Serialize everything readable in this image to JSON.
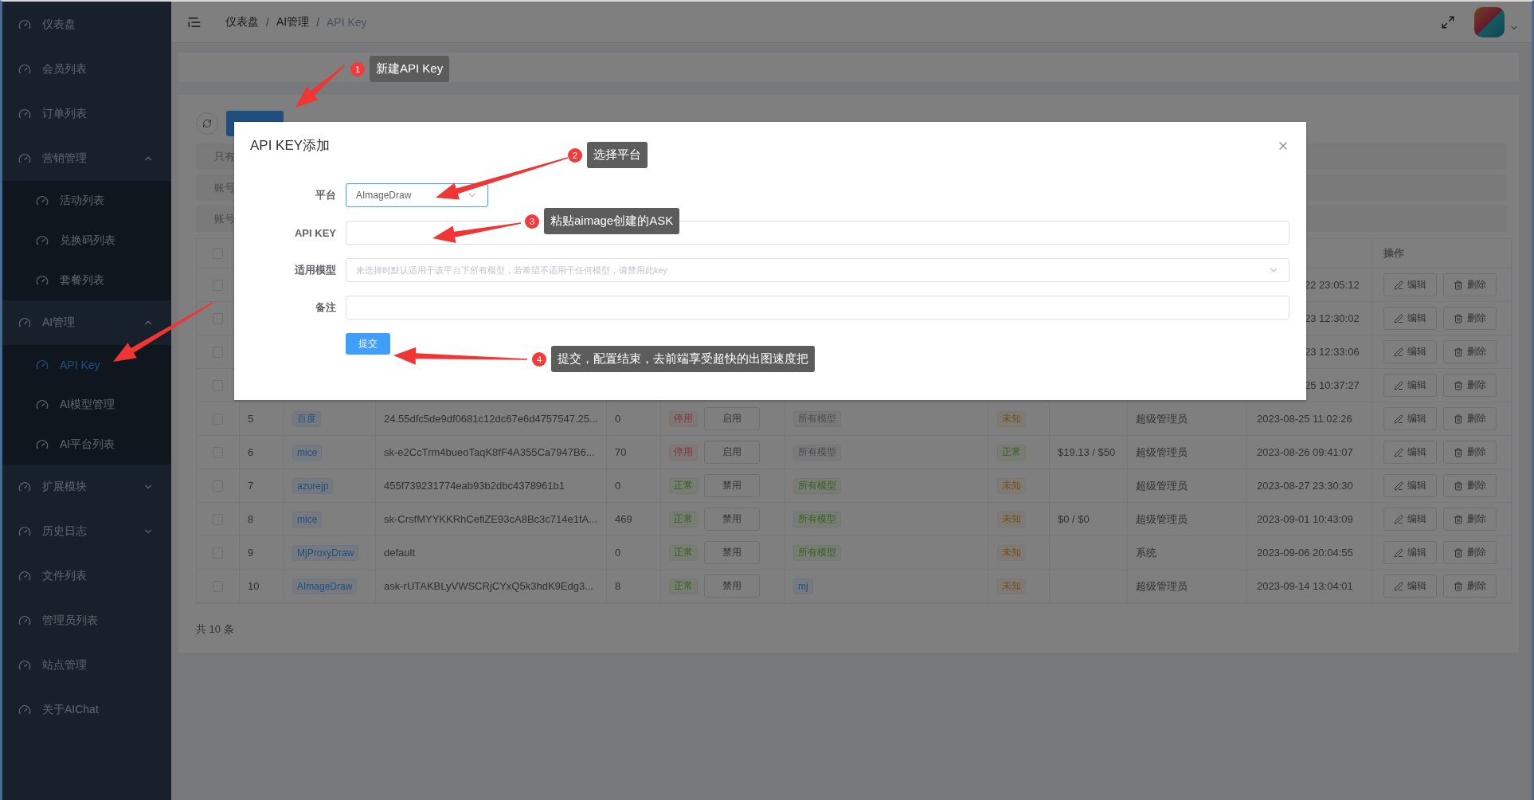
{
  "sidebar": {
    "items": [
      {
        "label": "仪表盘",
        "selected": false
      },
      {
        "label": "会员列表",
        "selected": false
      },
      {
        "label": "订单列表",
        "selected": false
      },
      {
        "label": "营销管理",
        "selected": false,
        "expanded": true,
        "children": [
          {
            "label": "活动列表",
            "selected": false
          },
          {
            "label": "兑换码列表",
            "selected": false
          },
          {
            "label": "套餐列表",
            "selected": false
          }
        ]
      },
      {
        "label": "AI管理",
        "selected": false,
        "expanded": true,
        "children": [
          {
            "label": "API Key",
            "selected": true
          },
          {
            "label": "AI模型管理",
            "selected": false
          },
          {
            "label": "AI平台列表",
            "selected": false
          }
        ]
      },
      {
        "label": "扩展模块",
        "selected": false,
        "expanded": false
      },
      {
        "label": "历史日志",
        "selected": false,
        "expanded": false
      },
      {
        "label": "文件列表",
        "selected": false
      },
      {
        "label": "管理员列表",
        "selected": false
      },
      {
        "label": "站点管理",
        "selected": false
      },
      {
        "label": "关于AIChat",
        "selected": false
      }
    ]
  },
  "header": {
    "breadcrumb": [
      {
        "kind": "link",
        "label": "仪表盘"
      },
      {
        "kind": "separator",
        "label": "/"
      },
      {
        "kind": "link",
        "label": "AI管理"
      },
      {
        "kind": "separator",
        "label": "/"
      },
      {
        "kind": "current",
        "label": "API Key"
      }
    ]
  },
  "filters": [
    {
      "label": "只有"
    },
    {
      "label": "账号"
    },
    {
      "label": "账号"
    }
  ],
  "table": {
    "header_checked": false,
    "action_column": "操作",
    "rows": [
      {
        "checked": false,
        "time": "22 23:05:12",
        "actions": [
          "编辑",
          "删除"
        ]
      },
      {
        "checked": false,
        "time": "23 12:30:02",
        "actions": [
          "编辑",
          "删除"
        ]
      },
      {
        "checked": false,
        "time": "23 12:33:06",
        "actions": [
          "编辑",
          "删除"
        ]
      },
      {
        "checked": false,
        "time": "25 10:37:27",
        "actions": [
          "编辑",
          "删除"
        ]
      },
      {
        "checked": false,
        "index": "5",
        "platform": "百度",
        "key": "24.55dfc5de9df0681c12dc67e6d4757547.25...",
        "quota": "0",
        "status": {
          "text": "停用",
          "kind": "danger"
        },
        "toggle": "启用",
        "models": {
          "text": "所有模型",
          "kind": "plain"
        },
        "check": {
          "text": "未知",
          "kind": "warning"
        },
        "creator": "超级管理员",
        "time": "2023-08-25 11:02:26",
        "actions": [
          "编辑",
          "删除"
        ]
      },
      {
        "checked": false,
        "index": "6",
        "platform": "mice",
        "key": "sk-e2CcTrm4bueoTaqK8fF4A355Ca7947B6...",
        "quota": "70",
        "status": {
          "text": "停用",
          "kind": "danger"
        },
        "toggle": "启用",
        "models": {
          "text": "所有模型",
          "kind": "plain"
        },
        "check": {
          "text": "正常",
          "kind": "success"
        },
        "balance": "$19.13 / $50",
        "creator": "超级管理员",
        "time": "2023-08-26 09:41:07",
        "actions": [
          "编辑",
          "删除"
        ]
      },
      {
        "checked": false,
        "index": "7",
        "platform": "azurejp",
        "key": "455f739231774eab93b2dbc4378961b1",
        "quota": "0",
        "status": {
          "text": "正常",
          "kind": "success"
        },
        "toggle": "禁用",
        "models": {
          "text": "所有模型",
          "kind": "success"
        },
        "check": {
          "text": "未知",
          "kind": "warning"
        },
        "creator": "超级管理员",
        "time": "2023-08-27 23:30:30",
        "actions": [
          "编辑",
          "删除"
        ]
      },
      {
        "checked": false,
        "index": "8",
        "platform": "mice",
        "key": "sk-CrsfMYYKKRhCefiZE93cA8Bc3c714e1fA...",
        "quota": "469",
        "status": {
          "text": "正常",
          "kind": "success"
        },
        "toggle": "禁用",
        "models": {
          "text": "所有模型",
          "kind": "success"
        },
        "check": {
          "text": "未知",
          "kind": "warning"
        },
        "balance": "$0 / $0",
        "creator": "超级管理员",
        "time": "2023-09-01 10:43:09",
        "actions": [
          "编辑",
          "删除"
        ]
      },
      {
        "checked": false,
        "index": "9",
        "platform": "MjProxyDraw",
        "key": "default",
        "quota": "0",
        "status": {
          "text": "正常",
          "kind": "success"
        },
        "toggle": "禁用",
        "models": {
          "text": "所有模型",
          "kind": "success"
        },
        "check": {
          "text": "未知",
          "kind": "warning"
        },
        "creator": "系统",
        "time": "2023-09-06 20:04:55",
        "actions": [
          "编辑",
          "删除"
        ]
      },
      {
        "checked": false,
        "index": "10",
        "platform": "AImageDraw",
        "key": "ask-rUTAKBLyVWSCRjCYxQ5k3hdK9Edg3...",
        "quota": "8",
        "status": {
          "text": "正常",
          "kind": "success"
        },
        "toggle": "禁用",
        "models": {
          "text": "mj",
          "kind": "info"
        },
        "check": {
          "text": "未知",
          "kind": "warning"
        },
        "creator": "超级管理员",
        "time": "2023-09-14 13:04:01",
        "actions": [
          "编辑",
          "删除"
        ]
      }
    ]
  },
  "footer": {
    "total": "共 10 条"
  },
  "modal": {
    "title": "API KEY添加",
    "fields": [
      {
        "kind": "select",
        "label": "平台",
        "value": "AImageDraw",
        "focused": true
      },
      {
        "kind": "text",
        "label": "API KEY",
        "focused": false
      },
      {
        "kind": "select",
        "label": "适用模型",
        "placeholder": "未选择时默认适用于该平台下所有模型，若希望不适用于任何模型，请禁用此key",
        "focused": false
      },
      {
        "kind": "textarea",
        "label": "备注",
        "focused": false
      }
    ],
    "submit": "提交"
  },
  "annotations": [
    {
      "number": "1",
      "text": "新建API Key"
    },
    {
      "number": "2",
      "text": "选择平台"
    },
    {
      "number": "3",
      "text": "粘贴aimage创建的ASK"
    },
    {
      "number": "4",
      "text": "提交，配置结束，去前端享受超快的出图速度把"
    }
  ]
}
